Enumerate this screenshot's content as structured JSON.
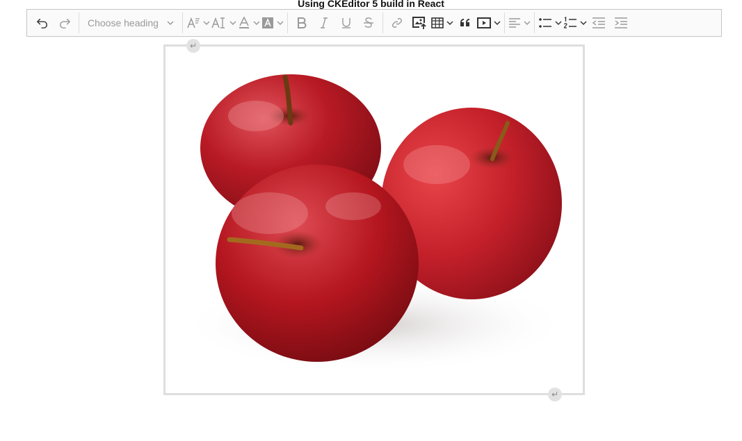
{
  "page": {
    "title": "Using CKEditor 5 build in React"
  },
  "toolbar": {
    "heading_placeholder": "Choose heading",
    "icons": {
      "undo": "undo-icon",
      "redo": "redo-icon",
      "font_size": "font-size-icon",
      "font_family": "font-family-icon",
      "font_color": "font-color-icon",
      "background_color": "font-background-color-icon",
      "bold": "bold-icon",
      "italic": "italic-icon",
      "underline": "underline-icon",
      "strikethrough": "strikethrough-icon",
      "link": "link-icon",
      "insert_image": "insert-image-icon",
      "insert_table": "table-icon",
      "block_quote": "blockquote-icon",
      "media_embed": "media-embed-icon",
      "alignment": "align-left-icon",
      "bulleted_list": "bulleted-list-icon",
      "numbered_list": "numbered-list-icon",
      "outdent": "outdent-icon",
      "indent": "indent-icon"
    }
  },
  "editor": {
    "image_alt": "Three red apples",
    "handle_symbol": "↵"
  },
  "colors": {
    "toolbar_border": "#c4c4c4",
    "frame_border": "#dedede",
    "apple_red": "#b3121c",
    "stem": "#8a5a1a"
  }
}
